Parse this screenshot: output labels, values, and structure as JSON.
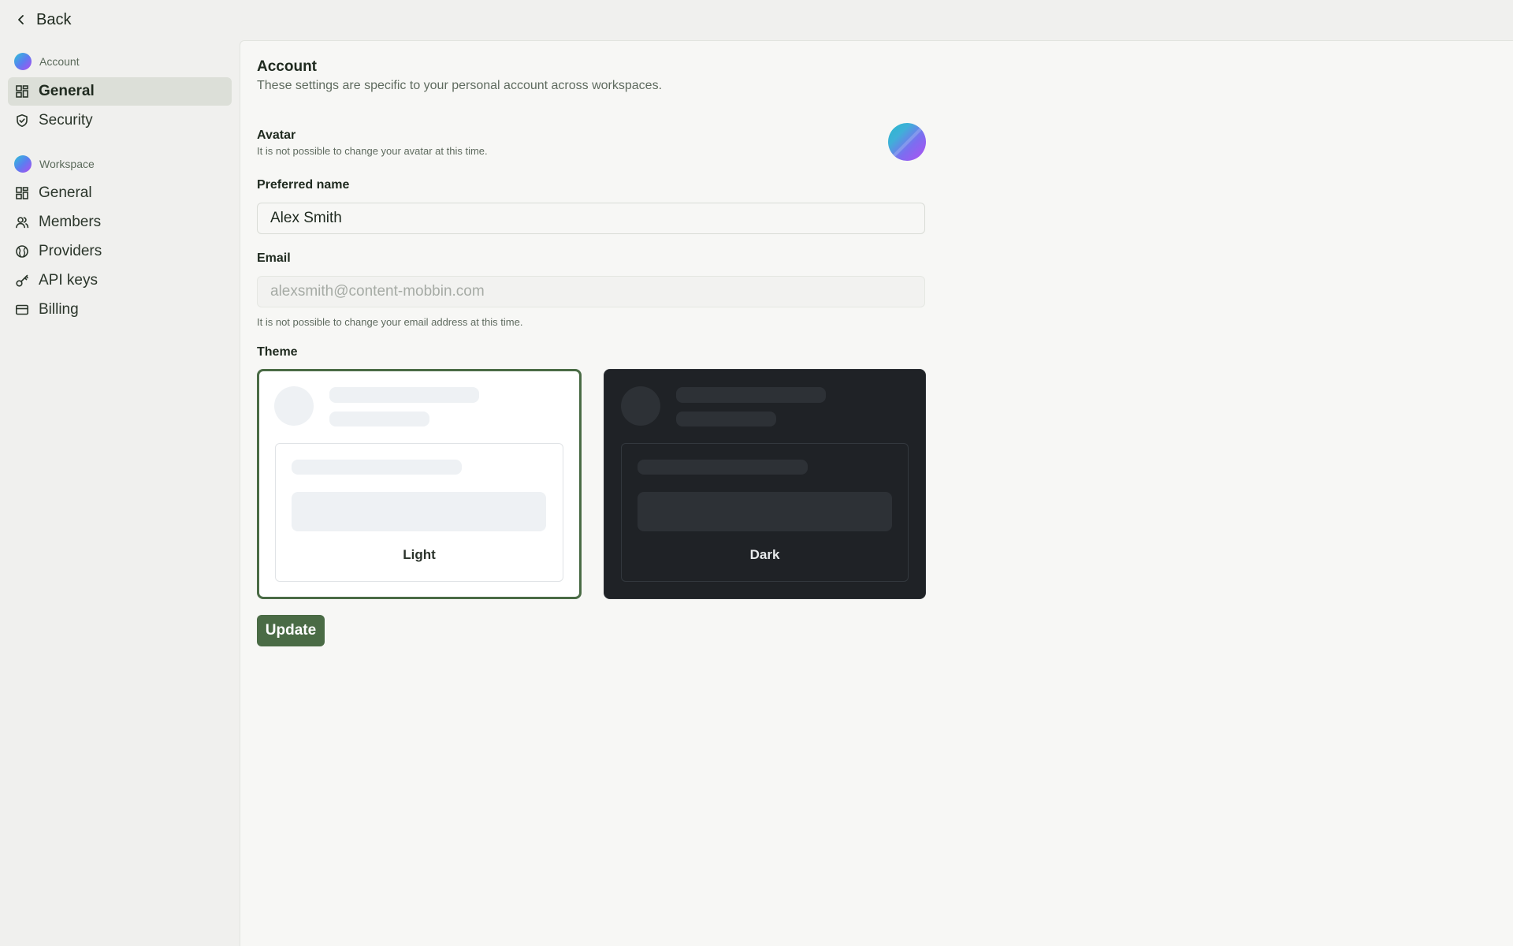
{
  "topbar": {
    "back_label": "Back"
  },
  "sidebar": {
    "account_section": "Account",
    "account_items": [
      {
        "label": "General",
        "icon": "grid-icon",
        "active": true
      },
      {
        "label": "Security",
        "icon": "shield-icon",
        "active": false
      }
    ],
    "workspace_section": "Workspace",
    "workspace_items": [
      {
        "label": "General",
        "icon": "grid-icon"
      },
      {
        "label": "Members",
        "icon": "users-icon"
      },
      {
        "label": "Providers",
        "icon": "globe-icon"
      },
      {
        "label": "API keys",
        "icon": "key-icon"
      },
      {
        "label": "Billing",
        "icon": "credit-card-icon"
      }
    ]
  },
  "main": {
    "title": "Account",
    "subtitle": "These settings are specific to your personal account across workspaces.",
    "avatar": {
      "label": "Avatar",
      "hint": "It is not possible to change your avatar at this time."
    },
    "preferred_name": {
      "label": "Preferred name",
      "value": "Alex Smith"
    },
    "email": {
      "label": "Email",
      "placeholder": "alexsmith@content-mobbin.com",
      "hint": "It is not possible to change your email address at this time."
    },
    "theme": {
      "label": "Theme",
      "options": [
        {
          "label": "Light",
          "selected": true
        },
        {
          "label": "Dark",
          "selected": false
        }
      ]
    },
    "update_label": "Update"
  },
  "colors": {
    "accent": "#4a6b45",
    "background": "#f0f0ee",
    "panel": "#f7f7f5",
    "dark_card": "#1f2226"
  }
}
